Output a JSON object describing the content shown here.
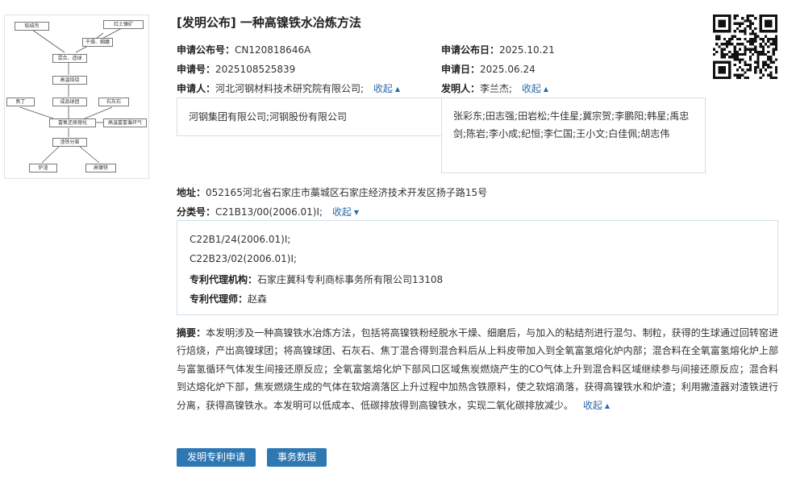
{
  "patent": {
    "title": "[发明公布] 一种高镍铁水冶炼方法",
    "pub_no_label": "申请公布号：",
    "pub_no": "CN120818646A",
    "pub_date_label": "申请公布日：",
    "pub_date": "2025.10.21",
    "app_no_label": "申请号：",
    "app_no": "2025108525839",
    "app_date_label": "申请日：",
    "app_date": "2025.06.24",
    "applicant_label": "申请人：",
    "applicant_first": "河北河钢材料技术研究院有限公司;",
    "applicant_more": "河钢集团有限公司;河钢股份有限公司",
    "inventor_label": "发明人：",
    "inventor_first": "李兰杰;",
    "inventor_more": "张彩东;田志强;田岩松;牛佳星;冀宗贺;李鹏阳;韩星;禹忠剑;陈岩;李小成;纪恒;李仁国;王小文;白佳佩;胡志伟",
    "collapse": "收起",
    "address_label": "地址：",
    "address": "052165河北省石家庄市藁城区石家庄经济技术开发区扬子路15号",
    "class_label": "分类号：",
    "class_first": "C21B13/00(2006.01)I;",
    "class_more_1": "C22B1/24(2006.01)I;",
    "class_more_2": "C22B23/02(2006.01)I;",
    "agency_label": "专利代理机构：",
    "agency": "石家庄冀科专利商标事务所有限公司13108",
    "agent_label": "专利代理师：",
    "agent": "赵森",
    "abstract_label": "摘要：",
    "abstract": "本发明涉及一种高镍铁水冶炼方法，包括将高镍铁粉经脱水干燥、细磨后，与加入的粘结剂进行混匀、制粒，获得的生球通过回转窑进行焙烧，产出高镍球团；将高镍球团、石灰石、焦丁混合得到混合料后从上料皮带加入到全氧富氢熔化炉内部；混合料在全氧富氢熔化炉上部与富氢循环气体发生间接还原反应；全氧富氢熔化炉下部风口区域焦炭燃烧产生的CO气体上升到混合料区域继续参与间接还原反应；混合料到达熔化炉下部，焦炭燃烧生成的气体在软熔滴落区上升过程中加热含铁原料，使之软熔滴落，获得高镍铁水和炉渣；利用撇渣器对渣铁进行分离，获得高镍铁水。本发明可以低成本、低碳排放得到高镍铁水，实现二氧化碳排放减少。",
    "buttons": {
      "apply": "发明专利申请",
      "events": "事务数据"
    }
  },
  "figure": {
    "boxes": {
      "binder": "粘结剂",
      "ore": "红土镍矿",
      "dry": "干燥、细磨",
      "mix": "混合、造球",
      "roast": "高温焙烧",
      "coke": "焦丁",
      "pellet": "成品球团",
      "lime": "石灰石",
      "furnace": "富氧还原熔化",
      "gas": "高温富氢循环气",
      "sep": "渣铁分离",
      "slag": "炉渣",
      "iron": "高镍铁"
    }
  },
  "colors": {
    "link": "#2a6aa8",
    "button": "#2d77b3",
    "panel_border": "#cfdfe8"
  }
}
